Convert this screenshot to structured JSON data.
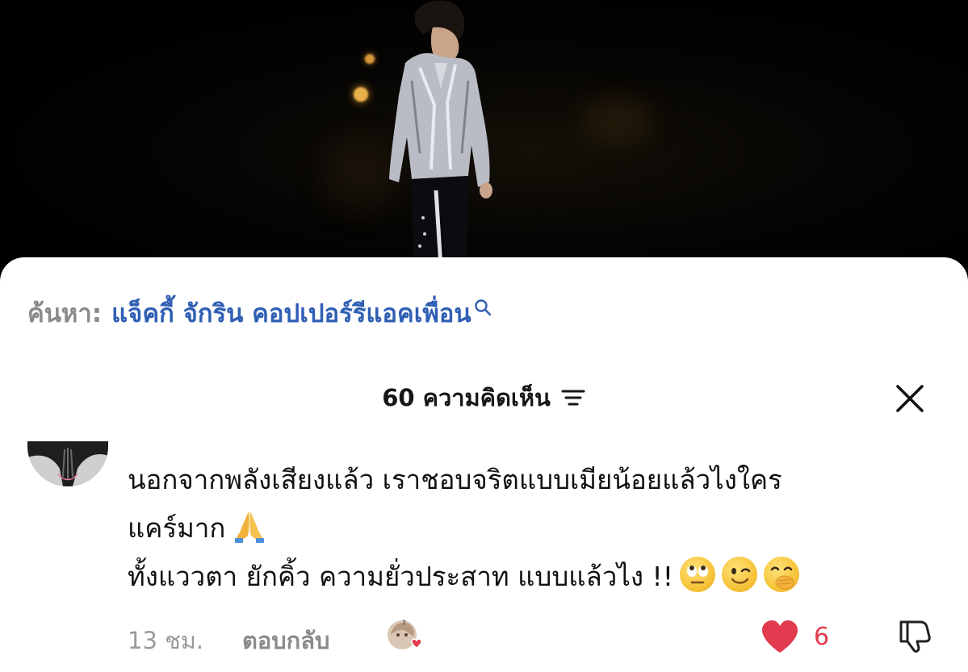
{
  "search": {
    "label": "ค้นหา:",
    "query": "แจ็คกี้ จักริน คอปเปอร์รีแอคเพื่อน"
  },
  "comments_header": {
    "count": "60",
    "title": "ความคิดเห็น"
  },
  "comment": {
    "line1": "นอกจากพลังเสียงแล้ว เราชอบจริตแบบเมียน้อยแล้วไงใคร",
    "line2": "แคร์มาก",
    "line3": "ทั้งแววตา ยักคิ้ว ความยั่วประสาท แบบแล้วไง !!",
    "time": "13 ชม.",
    "reply_label": "ตอบกลับ",
    "likes": "6"
  },
  "colors": {
    "accent_link": "#2f5fb4",
    "like_red": "#e23a4f",
    "muted_text": "#8a8a8a"
  },
  "icons": [
    "search-icon",
    "sort-icon",
    "close-icon",
    "pray-emoji",
    "eye-roll-emoji",
    "wink-emoji",
    "hand-over-mouth-emoji",
    "creator-like-avatar",
    "heart-icon",
    "dislike-icon"
  ]
}
